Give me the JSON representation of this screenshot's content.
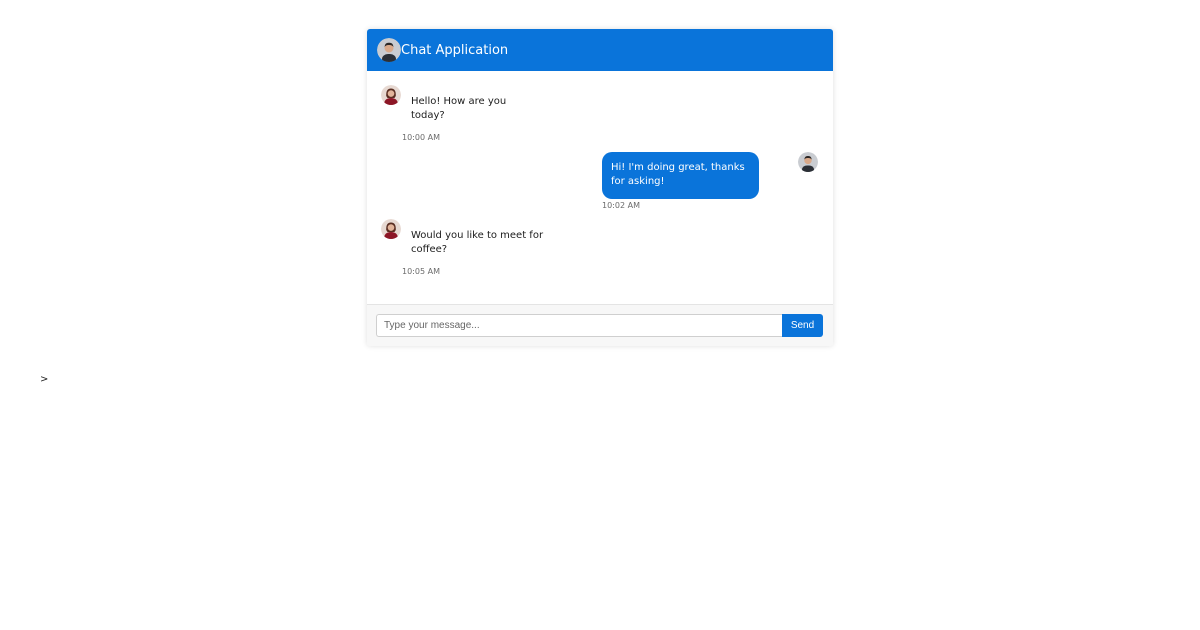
{
  "header": {
    "title": "Chat Application",
    "avatar_icon": "user-avatar-male",
    "background_color": "#0a74da"
  },
  "messages": [
    {
      "direction": "received",
      "text": "Hello! How are you today?",
      "time": "10:00 AM",
      "avatar_icon": "contact-avatar-female"
    },
    {
      "direction": "sent",
      "text": "Hi! I'm doing great, thanks for asking!",
      "time": "10:02 AM",
      "avatar_icon": "user-avatar-male",
      "bubble_color": "#0a74da"
    },
    {
      "direction": "received",
      "text": "Would you like to meet for coffee?",
      "time": "10:05 AM",
      "avatar_icon": "contact-avatar-female"
    }
  ],
  "composer": {
    "placeholder": "Type your message...",
    "value": "",
    "send_label": "Send"
  },
  "stray_text": ">"
}
